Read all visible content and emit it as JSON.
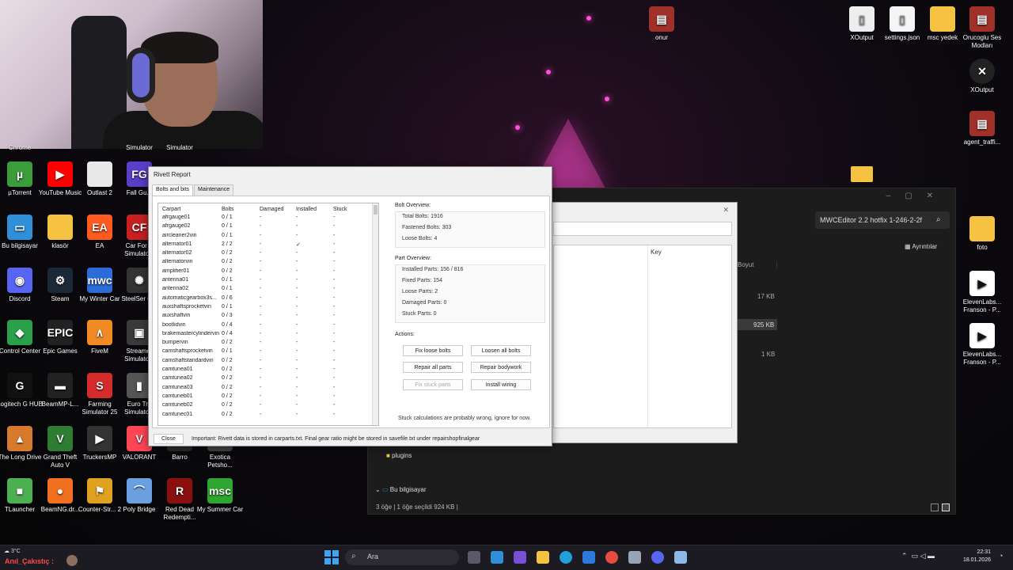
{
  "desktop": {
    "left_icons": [
      {
        "label": "µTorrent",
        "icon": "utorrent-icon",
        "color": "#3a9d3a",
        "glyph": "µ"
      },
      {
        "label": "YouTube Music",
        "icon": "youtube-music-icon",
        "color": "#ff0000",
        "glyph": "▶"
      },
      {
        "label": "Outlast 2",
        "icon": "file-icon",
        "color": "#e8e8e8",
        "glyph": ""
      },
      {
        "label": "Fall Gu...",
        "icon": "fall-guys-icon",
        "color": "#5a3ec8",
        "glyph": "FG"
      },
      {
        "label": "Bu bilgisayar",
        "icon": "computer-icon",
        "color": "#2f8fd8",
        "glyph": "▭"
      },
      {
        "label": "klasör",
        "icon": "folder-icon",
        "color": "#f5c242",
        "glyph": ""
      },
      {
        "label": "EA",
        "icon": "ea-icon",
        "color": "#ff5a1f",
        "glyph": "EA"
      },
      {
        "label": "Car For S Simulato...",
        "icon": "car-for-sale-icon",
        "color": "#c82020",
        "glyph": "CF"
      },
      {
        "label": "Discord",
        "icon": "discord-icon",
        "color": "#5865f2",
        "glyph": "◉"
      },
      {
        "label": "Steam",
        "icon": "steam-icon",
        "color": "#1b2838",
        "glyph": "⚙"
      },
      {
        "label": "My Winter Car",
        "icon": "my-winter-car-icon",
        "color": "#2b6cd8",
        "glyph": "mwc"
      },
      {
        "label": "SteelSer GG",
        "icon": "steelseries-icon",
        "color": "#333333",
        "glyph": "✺"
      },
      {
        "label": "Control Center",
        "icon": "control-center-icon",
        "color": "#2aa04a",
        "glyph": "◆"
      },
      {
        "label": "Epic Games",
        "icon": "epic-games-icon",
        "color": "#222222",
        "glyph": "EPIC"
      },
      {
        "label": "FiveM",
        "icon": "fivem-icon",
        "color": "#f08a24",
        "glyph": "∧"
      },
      {
        "label": "Streamer Simulato...",
        "icon": "streamer-sim-icon",
        "color": "#3a3a3a",
        "glyph": "▣"
      },
      {
        "label": "Logitech G HUB",
        "icon": "logitech-icon",
        "color": "#111111",
        "glyph": "G"
      },
      {
        "label": "BeamMP-L...",
        "icon": "beammp-icon",
        "color": "#222222",
        "glyph": "▬"
      },
      {
        "label": "Farming Simulator 25",
        "icon": "farming-sim-icon",
        "color": "#d52b2b",
        "glyph": "S"
      },
      {
        "label": "Euro Tru Simulato...",
        "icon": "euro-truck-icon",
        "color": "#555555",
        "glyph": "▮"
      },
      {
        "label": "The Long Drive",
        "icon": "the-long-drive-icon",
        "color": "#d87a2b",
        "glyph": "▲"
      },
      {
        "label": "Grand Theft Auto V",
        "icon": "gta-icon",
        "color": "#2e7d32",
        "glyph": "V"
      },
      {
        "label": "TruckersMP",
        "icon": "truckersmp-icon",
        "color": "#333333",
        "glyph": "▶"
      },
      {
        "label": "VALORANT",
        "icon": "valorant-icon",
        "color": "#ff4655",
        "glyph": "V"
      },
      {
        "label": "Barro",
        "icon": "barro-icon",
        "color": "#2a2a2a",
        "glyph": "▭"
      },
      {
        "label": "Exotica Petsho...",
        "icon": "exotica-icon",
        "color": "#444444",
        "glyph": "✦"
      },
      {
        "label": "TLauncher",
        "icon": "tlauncher-icon",
        "color": "#4caf50",
        "glyph": "■"
      },
      {
        "label": "BeamNG.dr...",
        "icon": "beamng-icon",
        "color": "#f07020",
        "glyph": "●"
      },
      {
        "label": "Counter-Str... 2",
        "icon": "cs2-icon",
        "color": "#e0a020",
        "glyph": "⚑"
      },
      {
        "label": "Poly Bridge",
        "icon": "poly-bridge-icon",
        "color": "#6aa0e0",
        "glyph": "⌒"
      },
      {
        "label": "Red Dead Redempti...",
        "icon": "rdr-icon",
        "color": "#8a1010",
        "glyph": "R"
      },
      {
        "label": "My Summer Car",
        "icon": "my-summer-car-icon",
        "color": "#2fa62f",
        "glyph": "msc"
      }
    ],
    "cut_labels": [
      "Chrome",
      "Simulator",
      "Simulator"
    ],
    "right_icons": [
      {
        "label": "onur",
        "icon": "winrar-icon"
      },
      {
        "label": "XOutput",
        "icon": "file-icon"
      },
      {
        "label": "settings.json",
        "icon": "file-icon"
      },
      {
        "label": "msc yedek",
        "icon": "folder-icon"
      },
      {
        "label": "Orucoglu Ses Modları",
        "icon": "winrar-icon"
      },
      {
        "label": "XOutput",
        "icon": "xoutput-icon"
      },
      {
        "label": "agent_traffi...",
        "icon": "winrar-icon"
      },
      {
        "label": "foto",
        "icon": "folder-icon"
      },
      {
        "label": "ElevenLabs... Franson - P...",
        "icon": "audio-file-icon"
      },
      {
        "label": "ElevenLabs... Franson - P...",
        "icon": "audio-file-icon"
      }
    ]
  },
  "explorer": {
    "search_text": "MWCEditor 2.2 hotfix 1-246-2-2f",
    "details_label": "Ayrıntılar",
    "size_header": "Boyut",
    "sizes": [
      "17 KB",
      "925 KB",
      "1 KB"
    ],
    "sidebar_items": [
      "plugins",
      "Bu bilgisayar"
    ],
    "status": "3 öğe  |  1 öğe seçildi  924 KB  |"
  },
  "editor": {
    "key_header": "Key"
  },
  "rivett": {
    "title": "Rivett Report",
    "tabs": [
      "Bolts and bits",
      "Maintenance"
    ],
    "columns": [
      "Carpart",
      "Bolts",
      "Damaged",
      "Installed",
      "Stuck"
    ],
    "rows": [
      [
        "afrgauge01",
        "0 / 1",
        "-",
        "-",
        "-"
      ],
      [
        "afrgauge02",
        "0 / 1",
        "-",
        "-",
        "-"
      ],
      [
        "aircleaner2vin",
        "0 / 1",
        "-",
        "-",
        "-"
      ],
      [
        "alternator01",
        "2 / 2",
        "-",
        "✓",
        "-"
      ],
      [
        "alternator02",
        "0 / 2",
        "-",
        "-",
        "-"
      ],
      [
        "alternatorvin",
        "0 / 2",
        "-",
        "-",
        "-"
      ],
      [
        "amplifier01",
        "0 / 2",
        "-",
        "-",
        "-"
      ],
      [
        "antenna01",
        "0 / 1",
        "-",
        "-",
        "-"
      ],
      [
        "antenna02",
        "0 / 1",
        "-",
        "-",
        "-"
      ],
      [
        "automaticgearbox3s...",
        "0 / 6",
        "-",
        "-",
        "-"
      ],
      [
        "auxshaftsprocketvin",
        "0 / 1",
        "-",
        "-",
        "-"
      ],
      [
        "auxshaftvin",
        "0 / 3",
        "-",
        "-",
        "-"
      ],
      [
        "bootlidvin",
        "0 / 4",
        "-",
        "-",
        "-"
      ],
      [
        "brakemastercylindervin",
        "0 / 4",
        "-",
        "-",
        "-"
      ],
      [
        "bumpervin",
        "0 / 2",
        "-",
        "-",
        "-"
      ],
      [
        "camshaftsprocketvin",
        "0 / 1",
        "-",
        "-",
        "-"
      ],
      [
        "camshaftstandardvin",
        "0 / 2",
        "-",
        "-",
        "-"
      ],
      [
        "camtunea01",
        "0 / 2",
        "-",
        "-",
        "-"
      ],
      [
        "camtunea02",
        "0 / 2",
        "-",
        "-",
        "-"
      ],
      [
        "camtunea03",
        "0 / 2",
        "-",
        "-",
        "-"
      ],
      [
        "camtuneb01",
        "0 / 2",
        "-",
        "-",
        "-"
      ],
      [
        "camtuneb02",
        "0 / 2",
        "-",
        "-",
        "-"
      ],
      [
        "camtunec01",
        "0 / 2",
        "-",
        "-",
        "-"
      ]
    ],
    "bolt_overview_title": "Bolt Overview:",
    "bolt_overview": [
      "Total Bolts: 1916",
      "Fastened Bolts: 303",
      "Loose Bolts: 4"
    ],
    "part_overview_title": "Part Overview:",
    "part_overview": [
      "Installed Parts: 156 / 816",
      "Fixed Parts: 154",
      "Loose Parts: 2",
      "Damaged Parts: 0",
      "Stuck Parts: 0"
    ],
    "actions_title": "Actions:",
    "buttons": {
      "fix_loose": "Fix loose bolts",
      "loosen_all": "Loosen all bolts",
      "repair_parts": "Repair all parts",
      "repair_body": "Repair bodywork",
      "fix_stuck": "Fix stuck parts",
      "install_wiring": "Install wiring"
    },
    "note": "Stuck calculations are probably wrong, ignore for now.",
    "close_label": "Close",
    "footer": "Important: Rivett data is stored in carparts.txt. Final gear ratio might be stored in savefile.txt under repairshopfinalgear"
  },
  "taskbar": {
    "search_placeholder": "Ara",
    "weather": "3°C",
    "overlay_name": "Anıl_Çakıstıç :",
    "time": "22:31",
    "date": "18.01.2026"
  }
}
